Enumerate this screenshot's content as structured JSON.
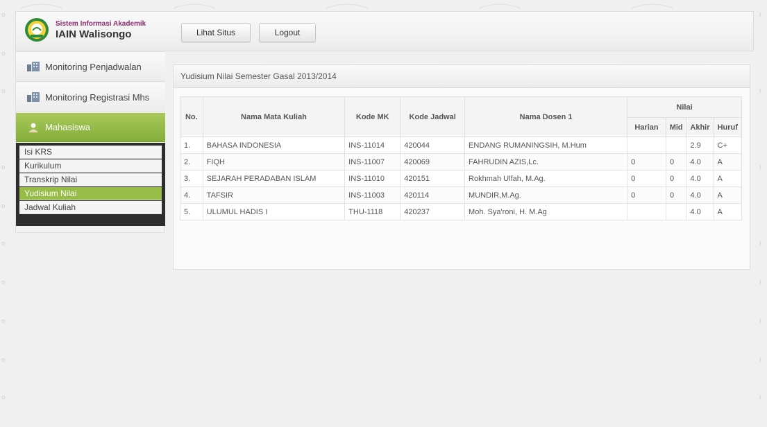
{
  "header": {
    "logo_line1": "Sistem Informasi Akademik",
    "logo_line2": "IAIN Walisongo",
    "buttons": {
      "site": "Lihat Situs",
      "logout": "Logout"
    }
  },
  "sidebar": {
    "items": [
      {
        "label": "Monitoring Penjadwalan",
        "icon": "building-icon"
      },
      {
        "label": "Monitoring Registrasi Mhs",
        "icon": "building-icon"
      },
      {
        "label": "Mahasiswa",
        "icon": "user-icon"
      }
    ],
    "submenu": [
      {
        "label": "Isi KRS"
      },
      {
        "label": "Kurikulum"
      },
      {
        "label": "Transkrip Nilai"
      },
      {
        "label": "Yudisium Nilai"
      },
      {
        "label": "Jadwal Kuliah"
      }
    ],
    "active_sub": "Yudisium Nilai"
  },
  "panel": {
    "title": "Yudisium Nilai Semester Gasal 2013/2014",
    "columns": {
      "no": "No.",
      "mata_kuliah": "Nama Mata Kuliah",
      "kode_mk": "Kode MK",
      "kode_jadwal": "Kode Jadwal",
      "dosen": "Nama Dosen 1",
      "nilai": "Nilai",
      "harian": "Harian",
      "mid": "Mid",
      "akhir": "Akhir",
      "huruf": "Huruf"
    },
    "rows": [
      {
        "no": "1.",
        "mk": "BAHASA INDONESIA",
        "kode": "INS-11014",
        "jadwal": "420044",
        "dosen": "ENDANG RUMANINGSIH, M.Hum",
        "harian": "",
        "mid": "",
        "akhir": "2.9",
        "huruf": "C+"
      },
      {
        "no": "2.",
        "mk": "FIQH",
        "kode": "INS-11007",
        "jadwal": "420069",
        "dosen": "FAHRUDIN AZIS,Lc.",
        "harian": "0",
        "mid": "0",
        "akhir": "4.0",
        "huruf": "A"
      },
      {
        "no": "3.",
        "mk": "SEJARAH PERADABAN ISLAM",
        "kode": "INS-11010",
        "jadwal": "420151",
        "dosen": "Rokhmah Ulfah, M.Ag.",
        "harian": "0",
        "mid": "0",
        "akhir": "4.0",
        "huruf": "A"
      },
      {
        "no": "4.",
        "mk": "TAFSIR",
        "kode": "INS-11003",
        "jadwal": "420114",
        "dosen": "MUNDIR,M.Ag.",
        "harian": "0",
        "mid": "0",
        "akhir": "4.0",
        "huruf": "A"
      },
      {
        "no": "5.",
        "mk": "ULUMUL HADIS I",
        "kode": "THU-1118",
        "jadwal": "420237",
        "dosen": "Moh. Sya'roni, H. M.Ag",
        "harian": "",
        "mid": "",
        "akhir": "4.0",
        "huruf": "A"
      }
    ]
  },
  "colors": {
    "accent_green": "#96bd46",
    "logo_purple": "#8a2c6e",
    "submenu_dark": "#2d2d2d"
  }
}
